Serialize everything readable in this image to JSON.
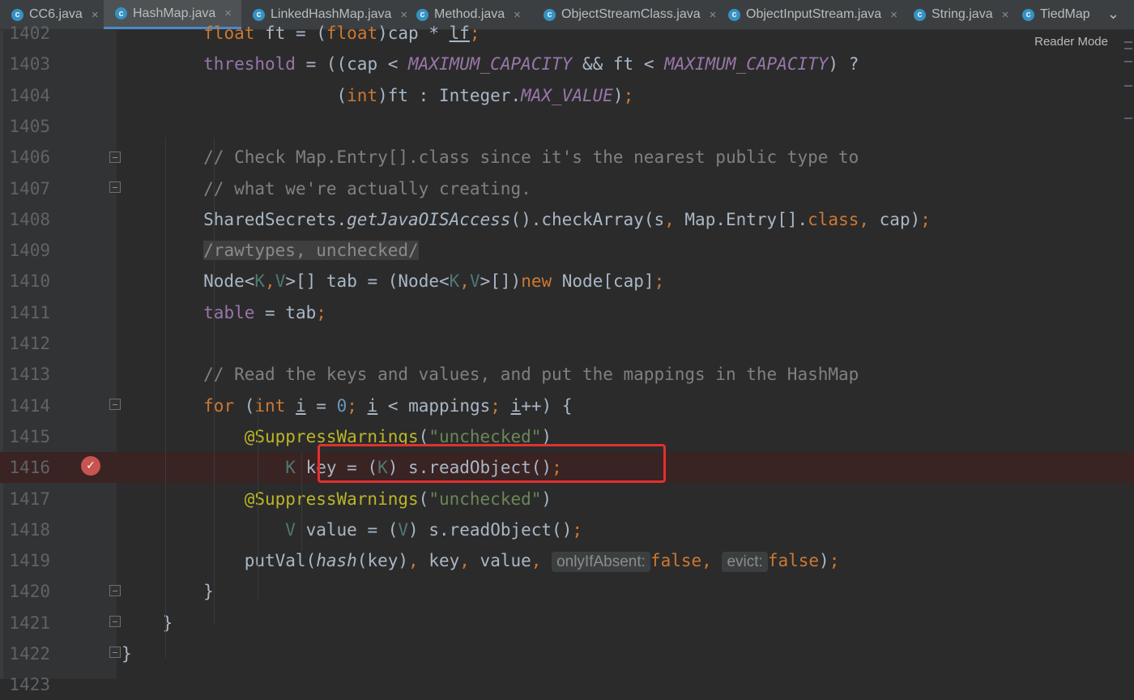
{
  "tabs": [
    {
      "label": "CC6.java",
      "active": false,
      "closable": true
    },
    {
      "label": "HashMap.java",
      "active": true,
      "closable": true
    },
    {
      "label": "LinkedHashMap.java",
      "active": false,
      "closable": true
    },
    {
      "label": "Method.java",
      "active": false,
      "closable": true
    },
    {
      "label": "ObjectStreamClass.java",
      "active": false,
      "closable": true
    },
    {
      "label": "ObjectInputStream.java",
      "active": false,
      "closable": true
    },
    {
      "label": "String.java",
      "active": false,
      "closable": true
    },
    {
      "label": "TiedMap",
      "active": false,
      "closable": false
    }
  ],
  "tab_icon_glyph": "c",
  "close_glyph": "×",
  "overflow_glyph": "⌄",
  "reader_mode_label": "Reader Mode",
  "breakpoint_line": "1416",
  "highlight_box_color": "#e23030",
  "lines": [
    {
      "num": "1402",
      "tokens": [
        [
          "",
          "        "
        ],
        [
          "k",
          "float"
        ],
        [
          "",
          " ft = ("
        ],
        [
          "k",
          "float"
        ],
        [
          "",
          ")cap * "
        ],
        [
          "u",
          "lf"
        ],
        [
          "k",
          ";"
        ]
      ]
    },
    {
      "num": "1403",
      "tokens": [
        [
          "",
          "        "
        ],
        [
          "f",
          "threshold"
        ],
        [
          "",
          " = ((cap < "
        ],
        [
          "fi",
          "MAXIMUM_CAPACITY"
        ],
        [
          "",
          " && ft < "
        ],
        [
          "fi",
          "MAXIMUM_CAPACITY"
        ],
        [
          "",
          ") ?"
        ]
      ]
    },
    {
      "num": "1404",
      "tokens": [
        [
          "",
          "                     ("
        ],
        [
          "k",
          "int"
        ],
        [
          "",
          ")ft : Integer."
        ],
        [
          "fi",
          "MAX_VALUE"
        ],
        [
          "",
          ")"
        ],
        [
          "k",
          ";"
        ]
      ]
    },
    {
      "num": "1405",
      "tokens": []
    },
    {
      "num": "1406",
      "tokens": [
        [
          "",
          "        "
        ],
        [
          "c",
          "// Check Map.Entry[].class since it's the nearest public type to"
        ]
      ]
    },
    {
      "num": "1407",
      "tokens": [
        [
          "",
          "        "
        ],
        [
          "c",
          "// what we're actually creating."
        ]
      ]
    },
    {
      "num": "1408",
      "tokens": [
        [
          "",
          "        SharedSecrets."
        ],
        [
          "it",
          "getJavaOISAccess"
        ],
        [
          "",
          "().checkArray(s"
        ],
        [
          "k",
          ","
        ],
        [
          "",
          " Map.Entry[]."
        ],
        [
          "k",
          "class"
        ],
        [
          "k",
          ","
        ],
        [
          "",
          " cap)"
        ],
        [
          "k",
          ";"
        ]
      ]
    },
    {
      "num": "1409",
      "tokens": [
        [
          "",
          "        "
        ],
        [
          "rt",
          "/rawtypes, unchecked/"
        ]
      ]
    },
    {
      "num": "1410",
      "tokens": [
        [
          "",
          "        Node<"
        ],
        [
          "t",
          "K"
        ],
        [
          "k",
          ","
        ],
        [
          "t",
          "V"
        ],
        [
          "",
          ">[] tab = (Node<"
        ],
        [
          "t",
          "K"
        ],
        [
          "k",
          ","
        ],
        [
          "t",
          "V"
        ],
        [
          "",
          ">[])"
        ],
        [
          "k",
          "new"
        ],
        [
          "",
          " Node[cap]"
        ],
        [
          "k",
          ";"
        ]
      ]
    },
    {
      "num": "1411",
      "tokens": [
        [
          "",
          "        "
        ],
        [
          "f",
          "table"
        ],
        [
          "",
          " = tab"
        ],
        [
          "k",
          ";"
        ]
      ]
    },
    {
      "num": "1412",
      "tokens": []
    },
    {
      "num": "1413",
      "tokens": [
        [
          "",
          "        "
        ],
        [
          "c",
          "// Read the keys and values, and put the mappings in the HashMap"
        ]
      ]
    },
    {
      "num": "1414",
      "tokens": [
        [
          "",
          "        "
        ],
        [
          "k",
          "for"
        ],
        [
          "",
          " ("
        ],
        [
          "k",
          "int"
        ],
        [
          "",
          " "
        ],
        [
          "u",
          "i"
        ],
        [
          "",
          " = "
        ],
        [
          "n",
          "0"
        ],
        [
          "k",
          ";"
        ],
        [
          "",
          " "
        ],
        [
          "u",
          "i"
        ],
        [
          "",
          " < mappings"
        ],
        [
          "k",
          ";"
        ],
        [
          "",
          " "
        ],
        [
          "u",
          "i"
        ],
        [
          "",
          "++) {"
        ]
      ]
    },
    {
      "num": "1415",
      "tokens": [
        [
          "",
          "            "
        ],
        [
          "a",
          "@SuppressWarnings"
        ],
        [
          "",
          "("
        ],
        [
          "s",
          "\"unchecked\""
        ],
        [
          "",
          ")"
        ]
      ]
    },
    {
      "num": "1416",
      "tokens": [
        [
          "",
          "                "
        ],
        [
          "t",
          "K"
        ],
        [
          "",
          " key = ("
        ],
        [
          "t",
          "K"
        ],
        [
          "",
          ") s.readObject()"
        ],
        [
          "k",
          ";"
        ]
      ]
    },
    {
      "num": "1417",
      "tokens": [
        [
          "",
          "            "
        ],
        [
          "a",
          "@SuppressWarnings"
        ],
        [
          "",
          "("
        ],
        [
          "s",
          "\"unchecked\""
        ],
        [
          "",
          ")"
        ]
      ]
    },
    {
      "num": "1418",
      "tokens": [
        [
          "",
          "                "
        ],
        [
          "t",
          "V"
        ],
        [
          "",
          " value = ("
        ],
        [
          "t",
          "V"
        ],
        [
          "",
          ") s.readObject()"
        ],
        [
          "k",
          ";"
        ]
      ]
    },
    {
      "num": "1419",
      "tokens": [
        [
          "",
          "            putVal("
        ],
        [
          "it",
          "hash"
        ],
        [
          "",
          "(key)"
        ],
        [
          "k",
          ","
        ],
        [
          "",
          " key"
        ],
        [
          "k",
          ","
        ],
        [
          "",
          " value"
        ],
        [
          "k",
          ","
        ],
        [
          "",
          " "
        ],
        [
          "hint",
          "onlyIfAbsent:"
        ],
        [
          "k",
          "false"
        ],
        [
          "k",
          ","
        ],
        [
          "",
          " "
        ],
        [
          "hint",
          "evict:"
        ],
        [
          "k",
          "false"
        ],
        [
          "",
          ")"
        ],
        [
          "k",
          ";"
        ]
      ]
    },
    {
      "num": "1420",
      "tokens": [
        [
          "",
          "        }"
        ]
      ]
    },
    {
      "num": "1421",
      "tokens": [
        [
          "",
          "    }"
        ]
      ]
    },
    {
      "num": "1422",
      "tokens": [
        [
          "",
          "}"
        ]
      ]
    },
    {
      "num": "1423",
      "tokens": []
    }
  ]
}
